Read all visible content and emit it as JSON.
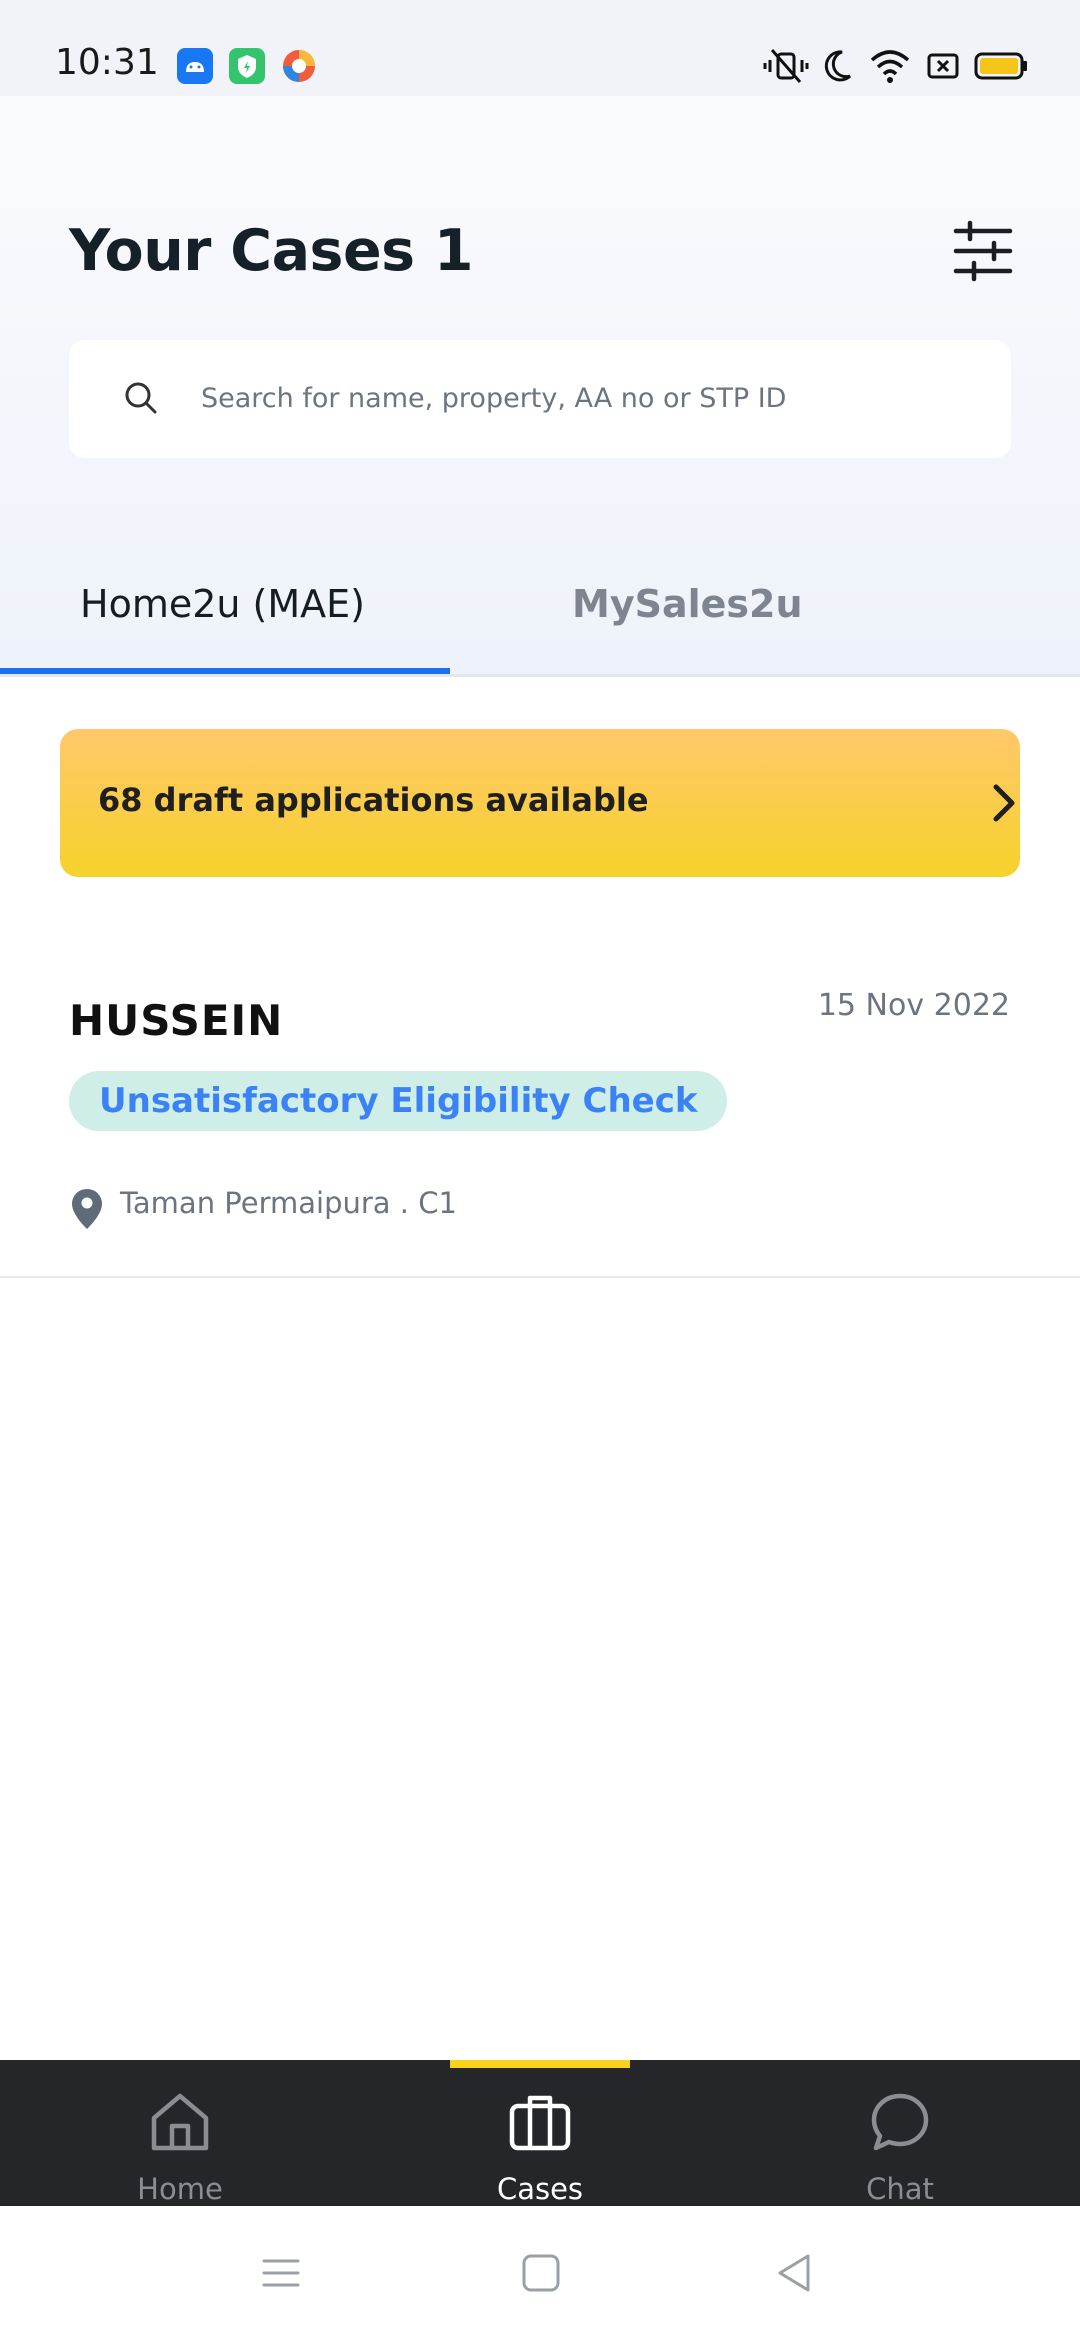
{
  "status_bar": {
    "time": "10:31",
    "app_icons": [
      "android-app-icon",
      "shield-app-icon",
      "color-app-icon"
    ],
    "system_icons": [
      "vibrate-off-icon",
      "moon-icon",
      "wifi-icon",
      "sim-icon",
      "battery-icon"
    ],
    "battery_color": "#f5c518"
  },
  "header": {
    "title": "Your Cases 1",
    "filter_icon": "sliders-icon"
  },
  "search": {
    "placeholder": "Search for name, property, AA no or STP ID"
  },
  "tabs": [
    {
      "label": "Home2u (MAE)",
      "active": true
    },
    {
      "label": "MySales2u",
      "active": false
    }
  ],
  "banner": {
    "text": "68 draft applications available",
    "icon": "chevron-right-icon"
  },
  "case": {
    "name": "HUSSEIN",
    "date": "15 Nov 2022",
    "status": "Unsatisfactory Eligibility Check",
    "location": "Taman Permaipura . C1"
  },
  "bottom_nav": {
    "items": [
      {
        "label": "Home",
        "icon": "home-icon",
        "active": false
      },
      {
        "label": "Cases",
        "icon": "briefcase-icon",
        "active": true
      },
      {
        "label": "Chat",
        "icon": "chat-bubble-icon",
        "active": false
      }
    ],
    "accent": "#f7d21a"
  },
  "system_nav": [
    "menu-key-icon",
    "home-key-icon",
    "back-key-icon"
  ],
  "colors": {
    "tab_underline": "#1e6ff0",
    "status_badge_bg": "#cfeee7",
    "status_badge_text": "#3b82f6"
  }
}
